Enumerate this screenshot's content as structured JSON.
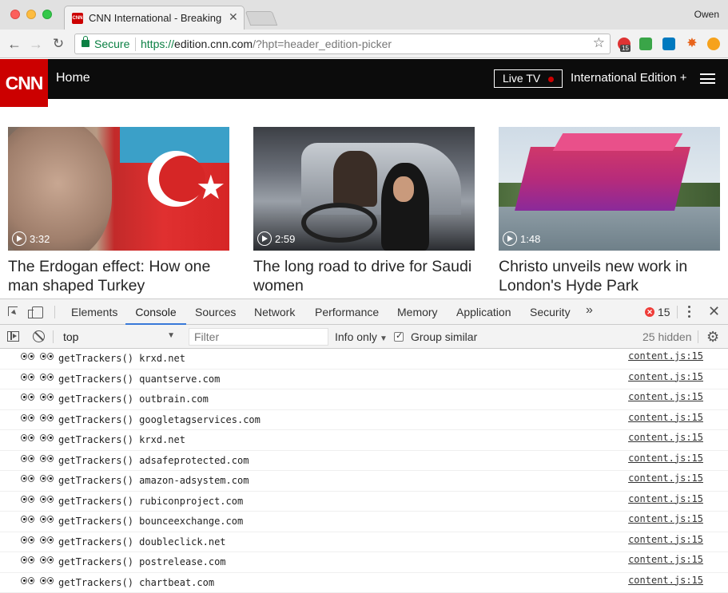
{
  "browser": {
    "tab_title": "CNN International - Breaking N",
    "profile_name": "Owen",
    "secure_label": "Secure",
    "url_scheme": "https://",
    "url_host": "edition.cnn.com",
    "url_path": "/?hpt=header_edition-picker",
    "favicon_text": "CNN",
    "extension_badge": "15"
  },
  "cnn": {
    "logo": "CNN",
    "home_label": "Home",
    "live_tv_label": "Live TV",
    "edition_label": "International Edition +",
    "cards": [
      {
        "duration": "3:32",
        "headline": "The Erdogan effect: How one man shaped Turkey"
      },
      {
        "duration": "2:59",
        "headline": "The long road to drive for Saudi women"
      },
      {
        "duration": "1:48",
        "headline": "Christo unveils new work in London's Hyde Park"
      }
    ]
  },
  "devtools": {
    "tabs": [
      "Elements",
      "Console",
      "Sources",
      "Network",
      "Performance",
      "Memory",
      "Application",
      "Security"
    ],
    "active_tab": "Console",
    "more_tabs": "»",
    "error_count": "15",
    "context": "top",
    "filter_placeholder": "Filter",
    "level": "Info only",
    "group_similar_label": "Group similar",
    "hidden_count": "25 hidden",
    "logs": [
      {
        "text": "getTrackers() krxd.net",
        "source": "content.js:15"
      },
      {
        "text": "getTrackers() quantserve.com",
        "source": "content.js:15"
      },
      {
        "text": "getTrackers() outbrain.com",
        "source": "content.js:15"
      },
      {
        "text": "getTrackers() googletagservices.com",
        "source": "content.js:15"
      },
      {
        "text": "getTrackers() krxd.net",
        "source": "content.js:15"
      },
      {
        "text": "getTrackers() adsafeprotected.com",
        "source": "content.js:15"
      },
      {
        "text": "getTrackers() amazon-adsystem.com",
        "source": "content.js:15"
      },
      {
        "text": "getTrackers() rubiconproject.com",
        "source": "content.js:15"
      },
      {
        "text": "getTrackers() bounceexchange.com",
        "source": "content.js:15"
      },
      {
        "text": "getTrackers() doubleclick.net",
        "source": "content.js:15"
      },
      {
        "text": "getTrackers() postrelease.com",
        "source": "content.js:15"
      },
      {
        "text": "getTrackers() chartbeat.com",
        "source": "content.js:15"
      }
    ]
  }
}
